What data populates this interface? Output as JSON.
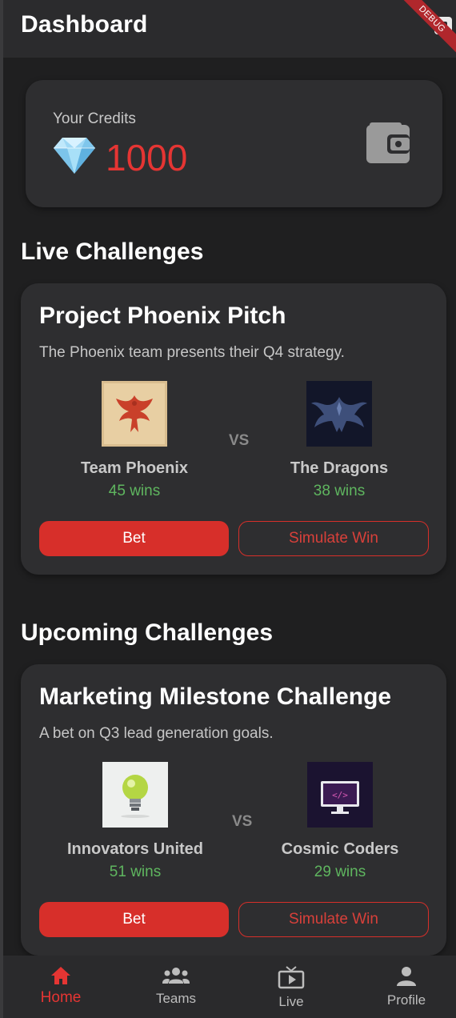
{
  "app": {
    "title": "Dashboard",
    "debug_banner": "DEBUG"
  },
  "credits": {
    "label": "Your Credits",
    "value": "1000"
  },
  "sections": {
    "live": "Live Challenges",
    "upcoming": "Upcoming Challenges"
  },
  "live_challenge": {
    "title": "Project Phoenix Pitch",
    "description": "The Phoenix team presents their Q4 strategy.",
    "team_a": {
      "name": "Team Phoenix",
      "wins": "45 wins"
    },
    "vs": "VS",
    "team_b": {
      "name": "The Dragons",
      "wins": "38 wins"
    },
    "bet_label": "Bet",
    "simulate_label": "Simulate Win"
  },
  "upcoming_challenge": {
    "title": "Marketing Milestone Challenge",
    "description": "A bet on Q3 lead generation goals.",
    "team_a": {
      "name": "Innovators United",
      "wins": "51 wins"
    },
    "vs": "VS",
    "team_b": {
      "name": "Cosmic Coders",
      "wins": "29 wins"
    },
    "bet_label": "Bet",
    "simulate_label": "Simulate Win"
  },
  "nav": {
    "items": [
      {
        "label": "Home",
        "icon": "home-icon",
        "active": true
      },
      {
        "label": "Teams",
        "icon": "groups-icon",
        "active": false
      },
      {
        "label": "Live",
        "icon": "live-tv-icon",
        "active": false
      },
      {
        "label": "Profile",
        "icon": "person-icon",
        "active": false
      }
    ]
  },
  "colors": {
    "accent": "#e53533",
    "button_red": "#d72f2a",
    "wins_green": "#5fb65f",
    "card_bg": "#2e2e30",
    "page_bg": "#1f1f20"
  }
}
